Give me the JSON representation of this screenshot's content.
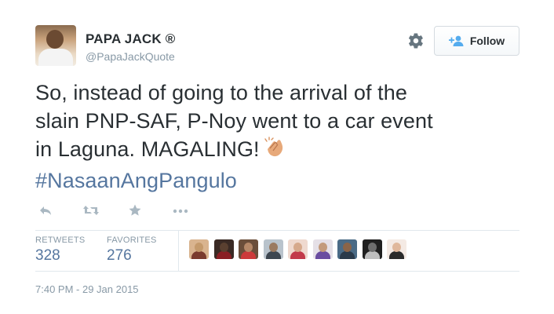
{
  "user": {
    "display_name": "PAPA JACK ®",
    "handle": "@PapaJackQuote"
  },
  "header": {
    "settings_icon": "gear-icon",
    "follow_icon": "add-user-icon",
    "follow_label": "Follow"
  },
  "tweet": {
    "line1": "So, instead of going to the arrival of the",
    "line2": "slain PNP-SAF, P-Noy went to a car event",
    "line3": "in Laguna. MAGALING!",
    "emoji": "clapping-hands-icon",
    "hashtag": "#NasaanAngPangulo"
  },
  "actions": {
    "icons": [
      "reply-icon",
      "retweet-icon",
      "favorite-icon",
      "more-icon"
    ]
  },
  "stats": {
    "retweets_label": "RETWEETS",
    "retweets_value": "328",
    "favorites_label": "FAVORITES",
    "favorites_value": "276"
  },
  "favoriters": [
    {
      "skin": "#c49a6c",
      "bg": "#d9b48f",
      "shirt": "#7a3b2e"
    },
    {
      "skin": "#5a4030",
      "bg": "#3a2a24",
      "shirt": "#8a1f24"
    },
    {
      "skin": "#b58868",
      "bg": "#6b4e3a",
      "shirt": "#cc3a3a"
    },
    {
      "skin": "#9a7a60",
      "bg": "#b9c3cc",
      "shirt": "#3d4650"
    },
    {
      "skin": "#d6a98c",
      "bg": "#efd9cf",
      "shirt": "#c23a4a"
    },
    {
      "skin": "#c39a7c",
      "bg": "#e5e0e7",
      "shirt": "#6a4da0"
    },
    {
      "skin": "#8a6448",
      "bg": "#4a6b86",
      "shirt": "#2a3a4a"
    },
    {
      "skin": "#6e6e6e",
      "bg": "#202020",
      "shirt": "#bfbfbf"
    },
    {
      "skin": "#e0b89c",
      "bg": "#f4eae4",
      "shirt": "#2b2b2b"
    }
  ],
  "timestamp": "7:40 PM - 29 Jan 2015",
  "colors": {
    "text": "#292f33",
    "muted": "#8899a6",
    "link": "#55769f",
    "action_icon": "#aab8c2",
    "divider": "#e1e8ed"
  }
}
